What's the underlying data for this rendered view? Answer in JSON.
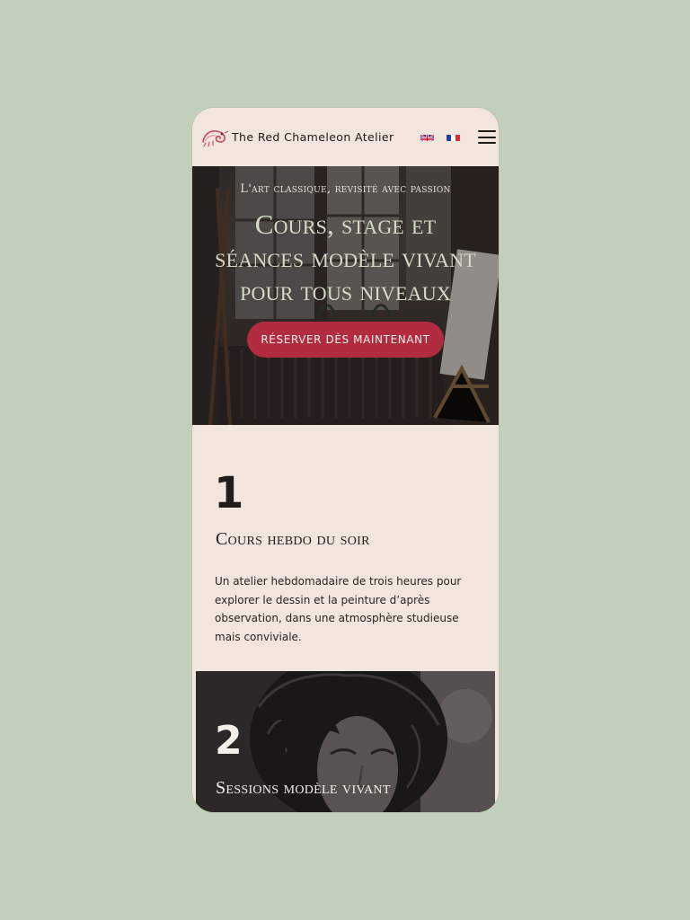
{
  "header": {
    "brand": "The Red Chameleon Atelier",
    "logo_icon": "chameleon-logo-icon",
    "languages": [
      {
        "code": "en",
        "icon": "uk-flag-icon"
      },
      {
        "code": "fr",
        "icon": "france-flag-icon"
      }
    ],
    "menu_icon": "hamburger-menu-icon"
  },
  "hero": {
    "subtitle": "L'art classique, revisité avec passion",
    "title_lines": [
      "Cours, stage et",
      "séances modèle vivant",
      "pour tous niveaux"
    ],
    "cta_label": "RÉSERVER DÈS MAINTENANT"
  },
  "sections": [
    {
      "number": "1",
      "title": "Cours hebdo du soir",
      "body": "Un atelier hebdomadaire de trois heures pour explorer le dessin et la peinture d’après observation, dans une atmosphère studieuse mais conviviale."
    },
    {
      "number": "2",
      "title": "Sessions modèle vivant"
    }
  ],
  "colors": {
    "page_background": "#c2cfba",
    "surface": "#f1e5de",
    "accent": "#b12c3f",
    "hero_title": "#d5dcc6",
    "text_dark": "#221c1a"
  }
}
